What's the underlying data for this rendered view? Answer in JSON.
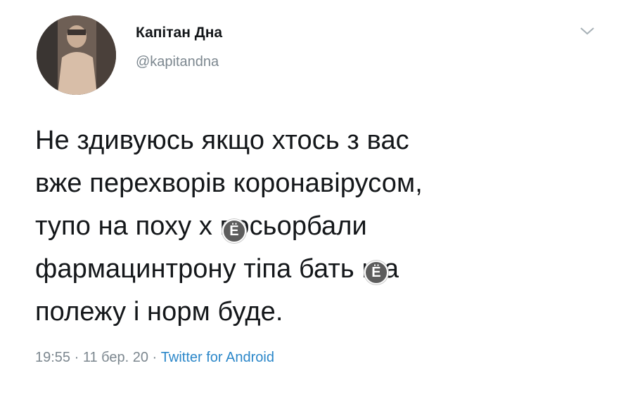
{
  "tweet": {
    "display_name": "Капітан Дна",
    "handle": "@kapitandna",
    "text": "Не здивуюсь якщо хтось з вас\nвже перехворів коронавірусом,\nтупо на поху х посьорбали\nфармацинтрону тіпа  бать ща\nполежу і норм буде.",
    "time": "19:55",
    "date": "11 бер. 20",
    "source": "Twitter for Android",
    "separator": " · "
  },
  "icons": {
    "chevron": "chevron-down-icon",
    "watermark": "watermark-badge"
  },
  "watermark_glyph": "Ё",
  "colors": {
    "text": "#14171a",
    "muted": "#7c878f",
    "link": "#2b87c9",
    "background": "#ffffff"
  }
}
